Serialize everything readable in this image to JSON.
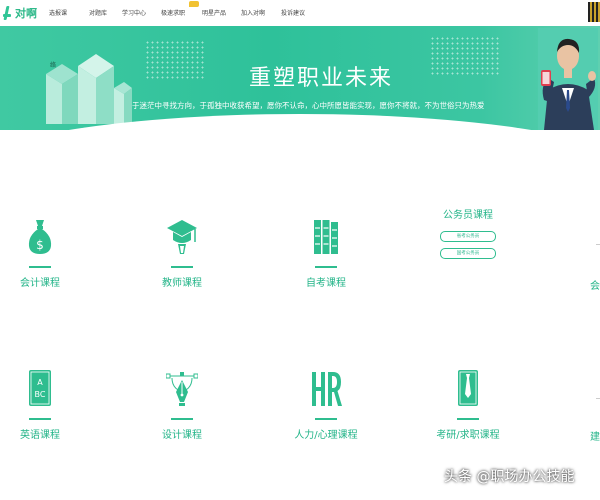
{
  "nav": {
    "logo_text": "对啊",
    "items": [
      {
        "label": "选报课"
      },
      {
        "label": "对题库"
      },
      {
        "label": "学习中心"
      },
      {
        "label": "极速求职"
      },
      {
        "label": "明星产品"
      },
      {
        "label": "加入对啊"
      },
      {
        "label": "投诉建议"
      }
    ]
  },
  "banner": {
    "title": "重塑职业未来",
    "subtitle": "于迷茫中寻找方向，于孤独中收获希望，愿你不认命，心中所愿皆能实现，愿你不将就，不为世俗只为热爱",
    "tiny_mark": "络"
  },
  "courses": {
    "accounting": {
      "label": "会计课程",
      "icon": "money-bag-icon"
    },
    "teacher": {
      "label": "教师课程",
      "icon": "graduation-cap-icon"
    },
    "self_exam": {
      "label": "自考课程",
      "icon": "books-icon"
    },
    "civil": {
      "title": "公务员课程",
      "pill1": "省考公务员",
      "pill2": "国考公务员"
    },
    "edge_row1": "会",
    "english": {
      "label": "英语课程",
      "icon": "abc-book-icon"
    },
    "design": {
      "label": "设计课程",
      "icon": "pen-tool-icon"
    },
    "hr": {
      "label": "人力/心理课程",
      "icon": "hr-icon"
    },
    "postgrad": {
      "label": "考研/求职课程",
      "icon": "tie-document-icon"
    },
    "edge_row2": "建"
  },
  "watermark": "头条 @职场办公技能",
  "colors": {
    "brand": "#2fbd8f",
    "banner": "#34c39c"
  }
}
